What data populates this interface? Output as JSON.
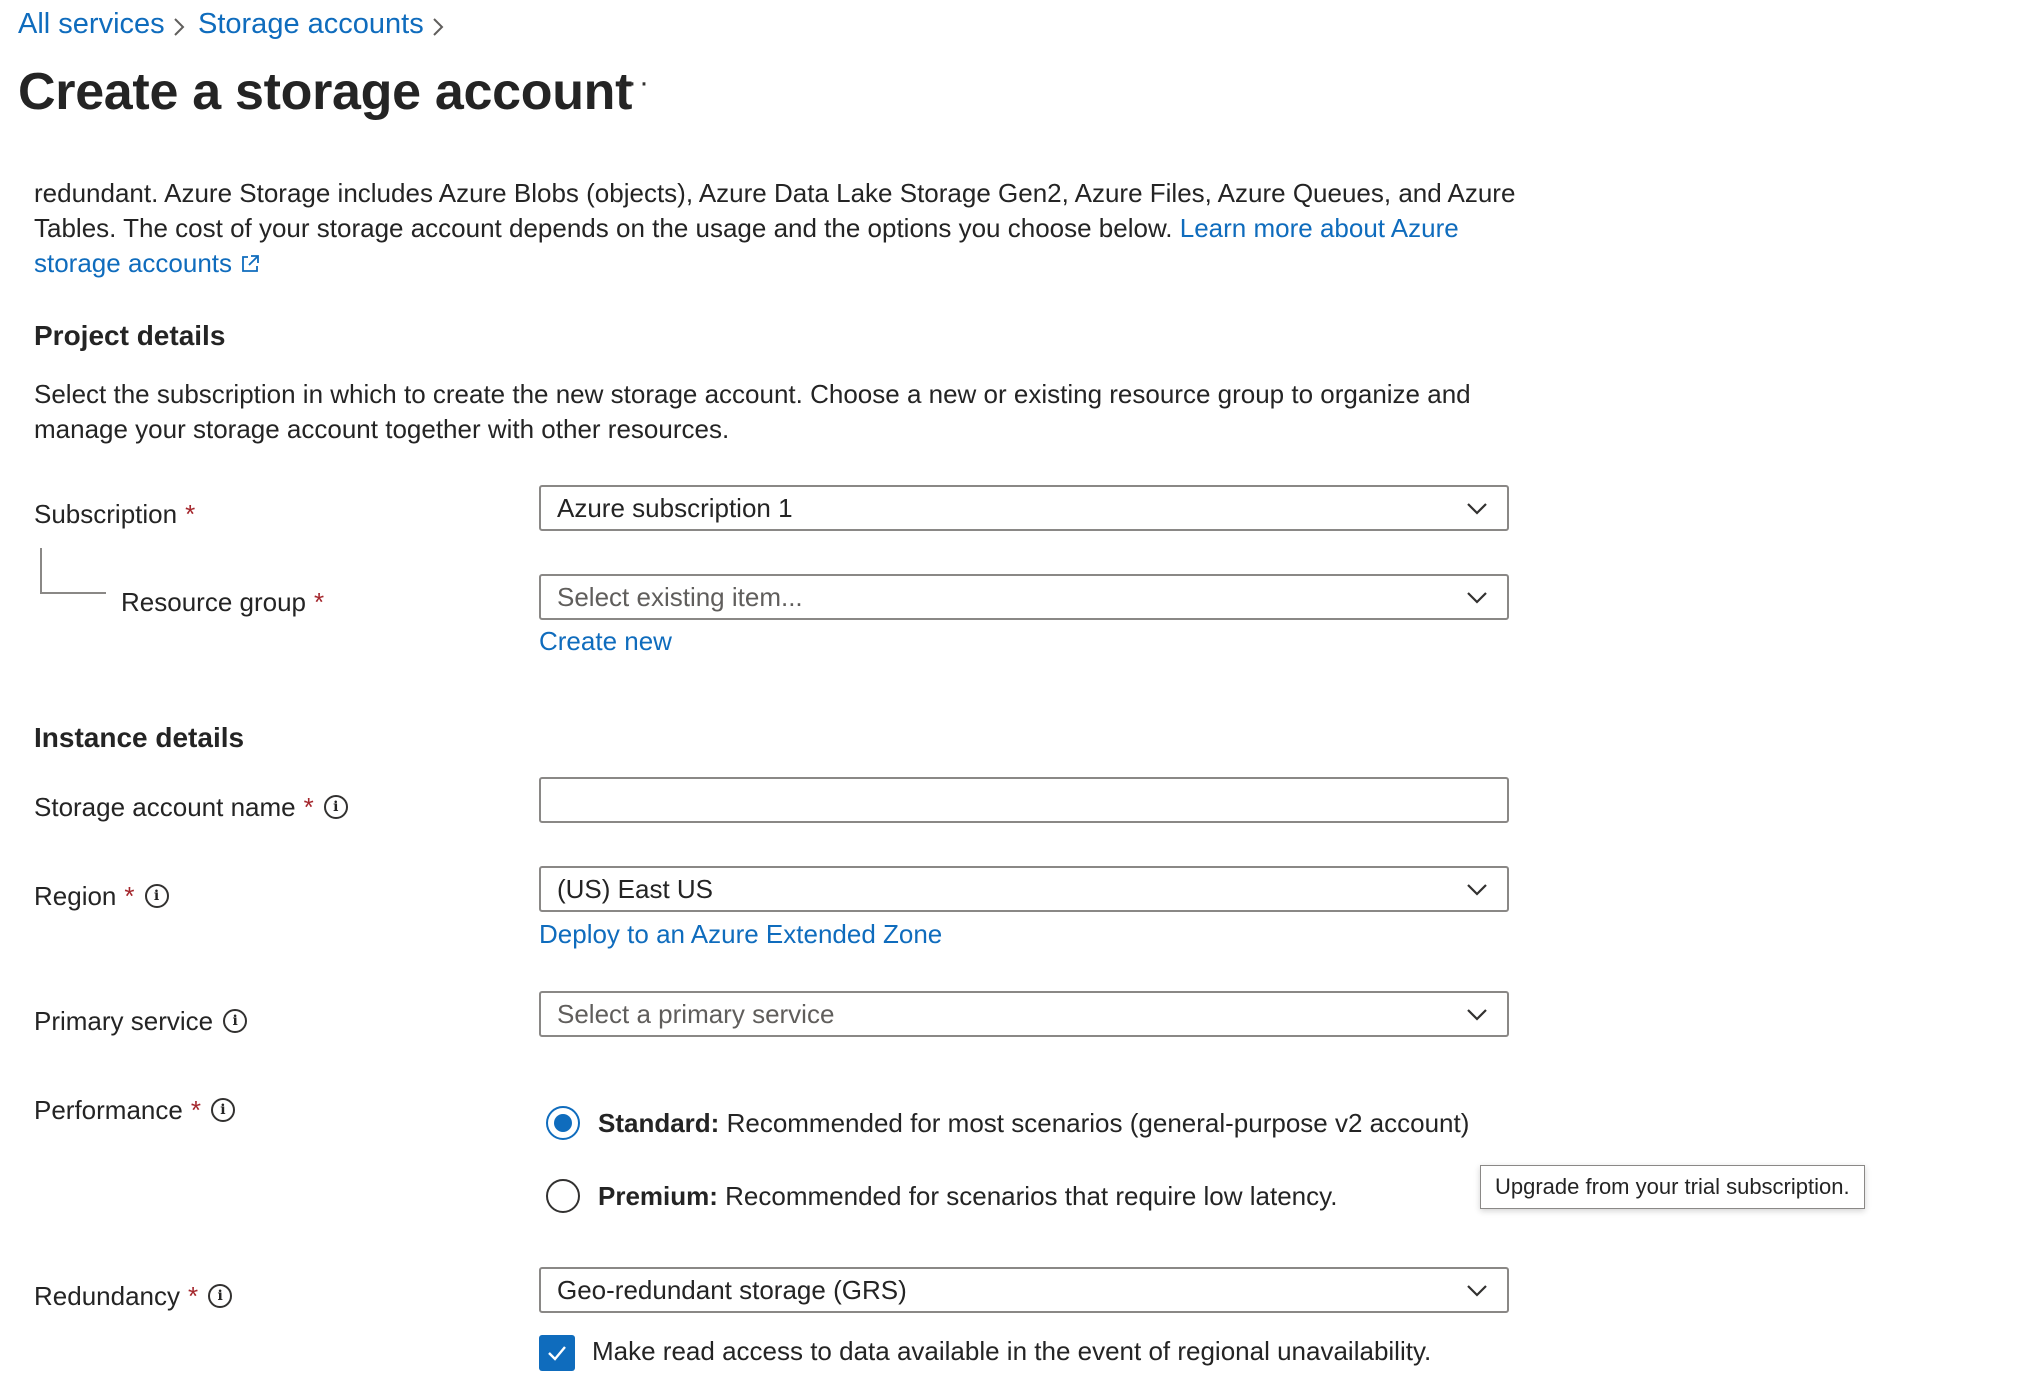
{
  "breadcrumb": [
    "All services",
    "Storage accounts"
  ],
  "page_title": "Create a storage account",
  "more_actions": "···",
  "intro": {
    "text": "redundant. Azure Storage includes Azure Blobs (objects), Azure Data Lake Storage Gen2, Azure Files, Azure Queues, and Azure Tables. The cost of your storage account depends on the usage and the options you choose below.",
    "link": "Learn more about Azure storage accounts"
  },
  "project": {
    "heading": "Project details",
    "description": "Select the subscription in which to create the new storage account. Choose a new or existing resource group to organize and manage your storage account together with other resources.",
    "subscription_label": "Subscription",
    "subscription_value": "Azure subscription 1",
    "resource_group_label": "Resource group",
    "resource_group_placeholder": "Select existing item...",
    "create_new": "Create new"
  },
  "instance": {
    "heading": "Instance details",
    "name_label": "Storage account name",
    "name_value": "",
    "region_label": "Region",
    "region_value": "(US) East US",
    "extended_zone_link": "Deploy to an Azure Extended Zone",
    "primary_service_label": "Primary service",
    "primary_service_placeholder": "Select a primary service",
    "performance_label": "Performance",
    "performance_options": [
      {
        "title": "Standard:",
        "desc": "Recommended for most scenarios (general-purpose v2 account)",
        "selected": true
      },
      {
        "title": "Premium:",
        "desc": "Recommended for scenarios that require low latency.",
        "selected": false
      }
    ],
    "premium_tooltip": "Upgrade from your trial subscription.",
    "redundancy_label": "Redundancy",
    "redundancy_value": "Geo-redundant storage (GRS)",
    "read_access_label": "Make read access to data available in the event of regional unavailability.",
    "read_access_checked": true
  },
  "required_marker": "*",
  "info_glyph": "i",
  "colors": {
    "link": "#0f6cbd",
    "required": "#a4262c",
    "text": "#242424",
    "border": "#8a8886"
  }
}
